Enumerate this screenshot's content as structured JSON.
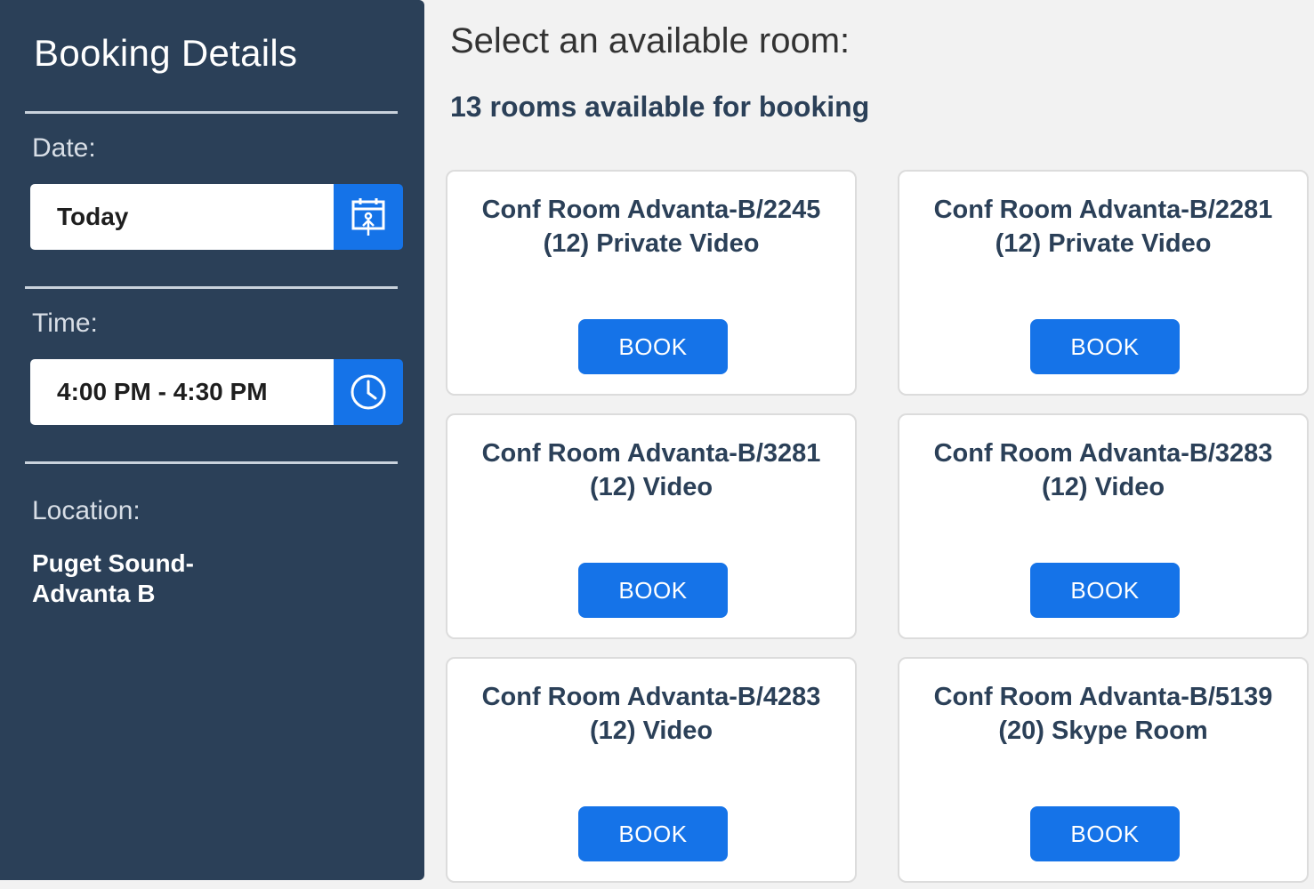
{
  "sidebar": {
    "title": "Booking Details",
    "date": {
      "label": "Date:",
      "value": "Today",
      "icon": "calendar-icon"
    },
    "time": {
      "label": "Time:",
      "value": "4:00 PM - 4:30 PM",
      "icon": "clock-icon"
    },
    "location": {
      "label": "Location:",
      "value_line1": "Puget Sound-",
      "value_line2": "Advanta B"
    }
  },
  "main": {
    "heading": "Select an available room:",
    "subheading": "13 rooms available for booking",
    "rooms": [
      {
        "name": "Conf Room Advanta-B/2245",
        "detail": "(12) Private Video",
        "button": "BOOK"
      },
      {
        "name": "Conf Room Advanta-B/2281",
        "detail": "(12) Private Video",
        "button": "BOOK"
      },
      {
        "name": "Conf Room Advanta-B/3281",
        "detail": "(12) Video",
        "button": "BOOK"
      },
      {
        "name": "Conf Room Advanta-B/3283",
        "detail": "(12) Video",
        "button": "BOOK"
      },
      {
        "name": "Conf Room Advanta-B/4283",
        "detail": "(12) Video",
        "button": "BOOK"
      },
      {
        "name": "Conf Room Advanta-B/5139",
        "detail": "(20) Skype Room",
        "button": "BOOK"
      }
    ]
  },
  "colors": {
    "sidebar_bg": "#2b4058",
    "accent": "#1573e8",
    "page_bg": "#f2f2f2"
  }
}
